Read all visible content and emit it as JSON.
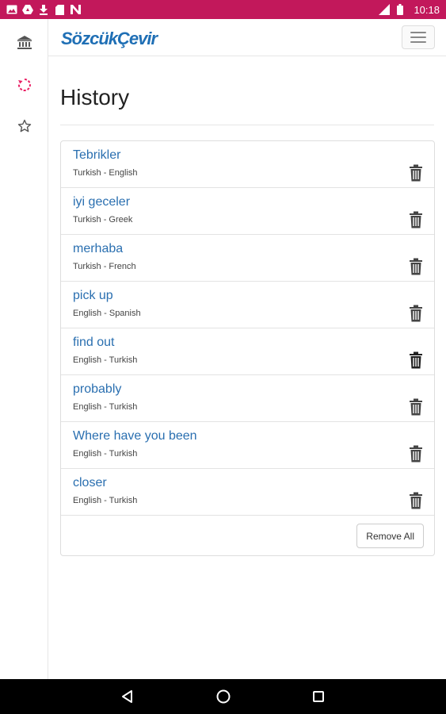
{
  "status_bar": {
    "time": "10:18",
    "left_icons": [
      "image-icon",
      "drive-icon",
      "download-icon",
      "sd-card-icon",
      "n-icon"
    ],
    "right_icons": [
      "signal-icon",
      "battery-icon"
    ]
  },
  "rail": {
    "items": [
      {
        "icon": "bank-icon",
        "active": false
      },
      {
        "icon": "history-icon",
        "active": true
      },
      {
        "icon": "star-icon",
        "active": false
      }
    ]
  },
  "header": {
    "brand": "SözcükÇevir",
    "menu_icon": "hamburger-icon"
  },
  "main": {
    "title": "History",
    "items": [
      {
        "term": "Tebrikler",
        "pair": "Turkish - English"
      },
      {
        "term": "iyi geceler",
        "pair": "Turkish - Greek"
      },
      {
        "term": "merhaba",
        "pair": "Turkish - French"
      },
      {
        "term": "pick up",
        "pair": "English - Spanish"
      },
      {
        "term": "find out",
        "pair": "English - Turkish"
      },
      {
        "term": "probably",
        "pair": "English - Turkish"
      },
      {
        "term": "Where have you been",
        "pair": "English - Turkish"
      },
      {
        "term": "closer",
        "pair": "English - Turkish"
      }
    ],
    "remove_all_label": "Remove All"
  },
  "colors": {
    "status_bar": "#c2185b",
    "accent": "#e91e63",
    "link": "#2a6fb0",
    "brand": "#1f6fb5"
  },
  "nav_bar": {
    "icons": [
      "back-icon",
      "home-icon",
      "recents-icon"
    ]
  }
}
